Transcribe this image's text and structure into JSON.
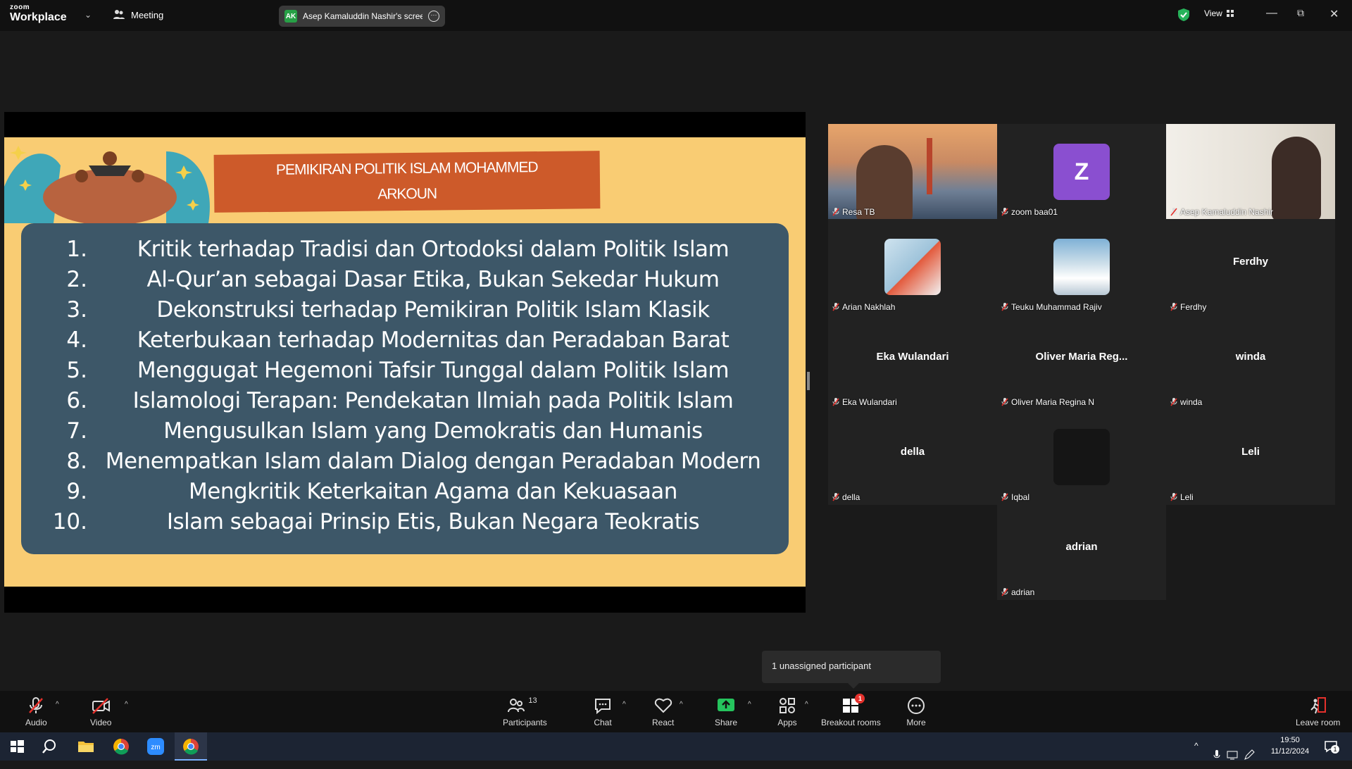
{
  "titlebar": {
    "logo_top": "zoom",
    "logo_bottom": "Workplace",
    "meeting_label": "Meeting",
    "share_initials": "AK",
    "share_label": "Asep Kamaluddin Nashir's screen",
    "view_label": "View"
  },
  "slide": {
    "title_line1": "PEMIKIRAN POLITIK ISLAM MOHAMMED",
    "title_line2": "ARKOUN",
    "items": [
      {
        "num": "1.",
        "text": "Kritik terhadap Tradisi dan Ortodoksi dalam Politik Islam"
      },
      {
        "num": "2.",
        "text": "Al-Qur’an sebagai Dasar Etika, Bukan Sekedar Hukum"
      },
      {
        "num": "3.",
        "text": "Dekonstruksi terhadap Pemikiran Politik Islam Klasik"
      },
      {
        "num": "4.",
        "text": "Keterbukaan terhadap Modernitas dan Peradaban Barat"
      },
      {
        "num": "5.",
        "text": "Menggugat Hegemoni Tafsir Tunggal dalam Politik Islam"
      },
      {
        "num": "6.",
        "text": "Islamologi Terapan: Pendekatan Ilmiah pada Politik Islam"
      },
      {
        "num": "7.",
        "text": "Mengusulkan Islam yang Demokratis dan Humanis"
      },
      {
        "num": "8.",
        "text": "Menempatkan Islam dalam Dialog dengan Peradaban Modern"
      },
      {
        "num": "9.",
        "text": "Mengkritik Keterkaitan Agama dan Kekuasaan"
      },
      {
        "num": "10.",
        "text": "Islam sebagai Prinsip Etis, Bukan Negara Teokratis"
      }
    ]
  },
  "participants": [
    {
      "name": "Resa TB",
      "center": "",
      "kind": "video"
    },
    {
      "name": "zoom baa01",
      "center": "Z",
      "kind": "letter"
    },
    {
      "name": "Asep Kamaluddin Nashir",
      "center": "",
      "kind": "video-active"
    },
    {
      "name": "Arian Nakhlah",
      "center": "",
      "kind": "pic"
    },
    {
      "name": "Teuku Muhammad Rajiv",
      "center": "",
      "kind": "pic"
    },
    {
      "name": "Ferdhy",
      "center": "Ferdhy",
      "kind": "text"
    },
    {
      "name": "Eka Wulandari",
      "center": "Eka Wulandari",
      "kind": "text"
    },
    {
      "name": "Oliver Maria Regina N",
      "center": "Oliver Maria Reg...",
      "kind": "text"
    },
    {
      "name": "winda",
      "center": "winda",
      "kind": "text"
    },
    {
      "name": "della",
      "center": "della",
      "kind": "text"
    },
    {
      "name": "Iqbal",
      "center": "",
      "kind": "dark"
    },
    {
      "name": "Leli",
      "center": "Leli",
      "kind": "text"
    },
    {
      "name": "adrian",
      "center": "adrian",
      "kind": "text"
    }
  ],
  "tooltip": "1 unassigned participant",
  "toolbar": {
    "audio": "Audio",
    "video": "Video",
    "participants": "Participants",
    "participants_count": "13",
    "chat": "Chat",
    "react": "React",
    "share": "Share",
    "apps": "Apps",
    "breakout": "Breakout rooms",
    "breakout_badge": "1",
    "more": "More",
    "leave": "Leave room"
  },
  "taskbar": {
    "time": "19:50",
    "date": "11/12/2024",
    "notif_count": "1"
  }
}
